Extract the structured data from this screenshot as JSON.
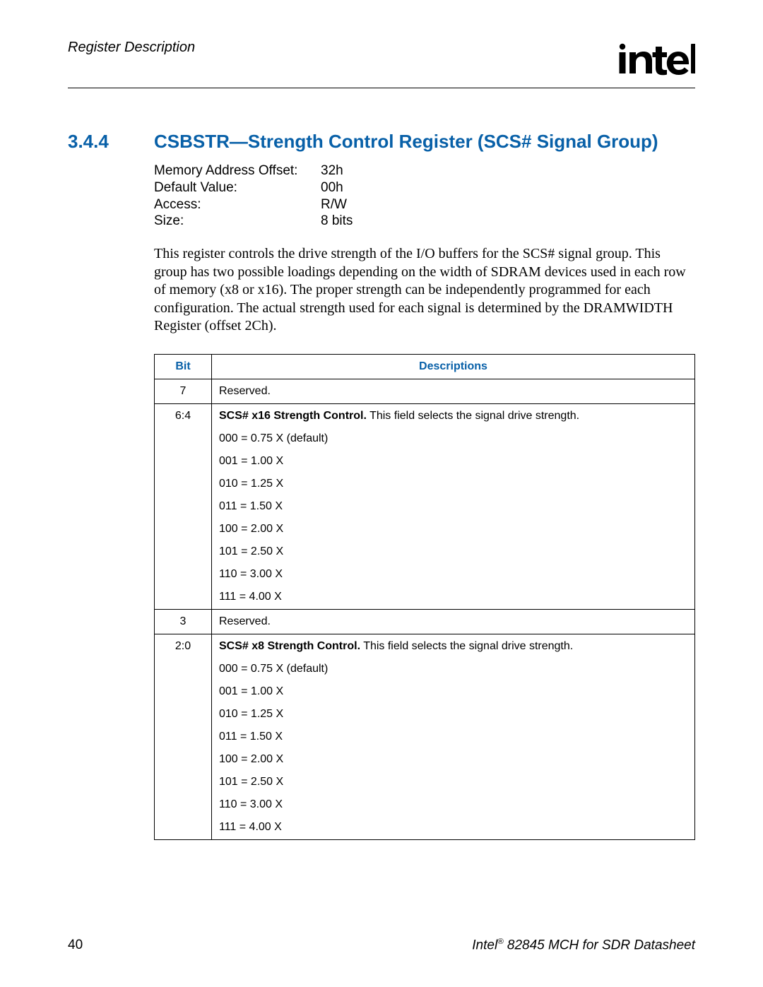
{
  "header": {
    "running_title": "Register Description"
  },
  "section": {
    "number": "3.4.4",
    "title": "CSBSTR—Strength Control Register (SCS# Signal Group)"
  },
  "register_info": {
    "labels": {
      "offset": "Memory Address Offset:",
      "default": "Default Value:",
      "access": "Access:",
      "size": "Size:"
    },
    "values": {
      "offset": "32h",
      "default": "00h",
      "access": "R/W",
      "size": "8 bits"
    }
  },
  "paragraph": "This register controls the drive strength of the I/O buffers for the SCS# signal group. This group has two possible loadings depending on the width of SDRAM devices used in each row of memory (x8 or x16). The proper strength can be independently programmed for each configuration. The actual strength used for each signal is determined by the DRAMWIDTH Register (offset 2Ch).",
  "table": {
    "headers": {
      "bit": "Bit",
      "desc": "Descriptions"
    },
    "rows": [
      {
        "bit": "7",
        "desc_title": "",
        "desc_rest": "Reserved.",
        "values": []
      },
      {
        "bit": "6:4",
        "desc_title": "SCS# x16 Strength Control.",
        "desc_rest": " This field selects the signal drive strength.",
        "values": [
          "000 = 0.75 X (default)",
          "001 = 1.00 X",
          "010 = 1.25 X",
          "011 = 1.50 X",
          "100 = 2.00 X",
          "101 = 2.50 X",
          "110 = 3.00 X",
          "111 = 4.00 X"
        ]
      },
      {
        "bit": "3",
        "desc_title": "",
        "desc_rest": "Reserved.",
        "values": []
      },
      {
        "bit": "2:0",
        "desc_title": "SCS# x8 Strength Control.",
        "desc_rest": " This field selects the signal drive strength.",
        "values": [
          "000 = 0.75 X (default)",
          "001 = 1.00 X",
          "010 = 1.25 X",
          "011 = 1.50 X",
          "100 = 2.00 X",
          "101 = 2.50 X",
          "110 = 3.00 X",
          "111 = 4.00 X"
        ]
      }
    ]
  },
  "footer": {
    "page_number": "40",
    "doc_title_pre": "Intel",
    "doc_title_sup": "®",
    "doc_title_post": " 82845 MCH for SDR Datasheet"
  }
}
